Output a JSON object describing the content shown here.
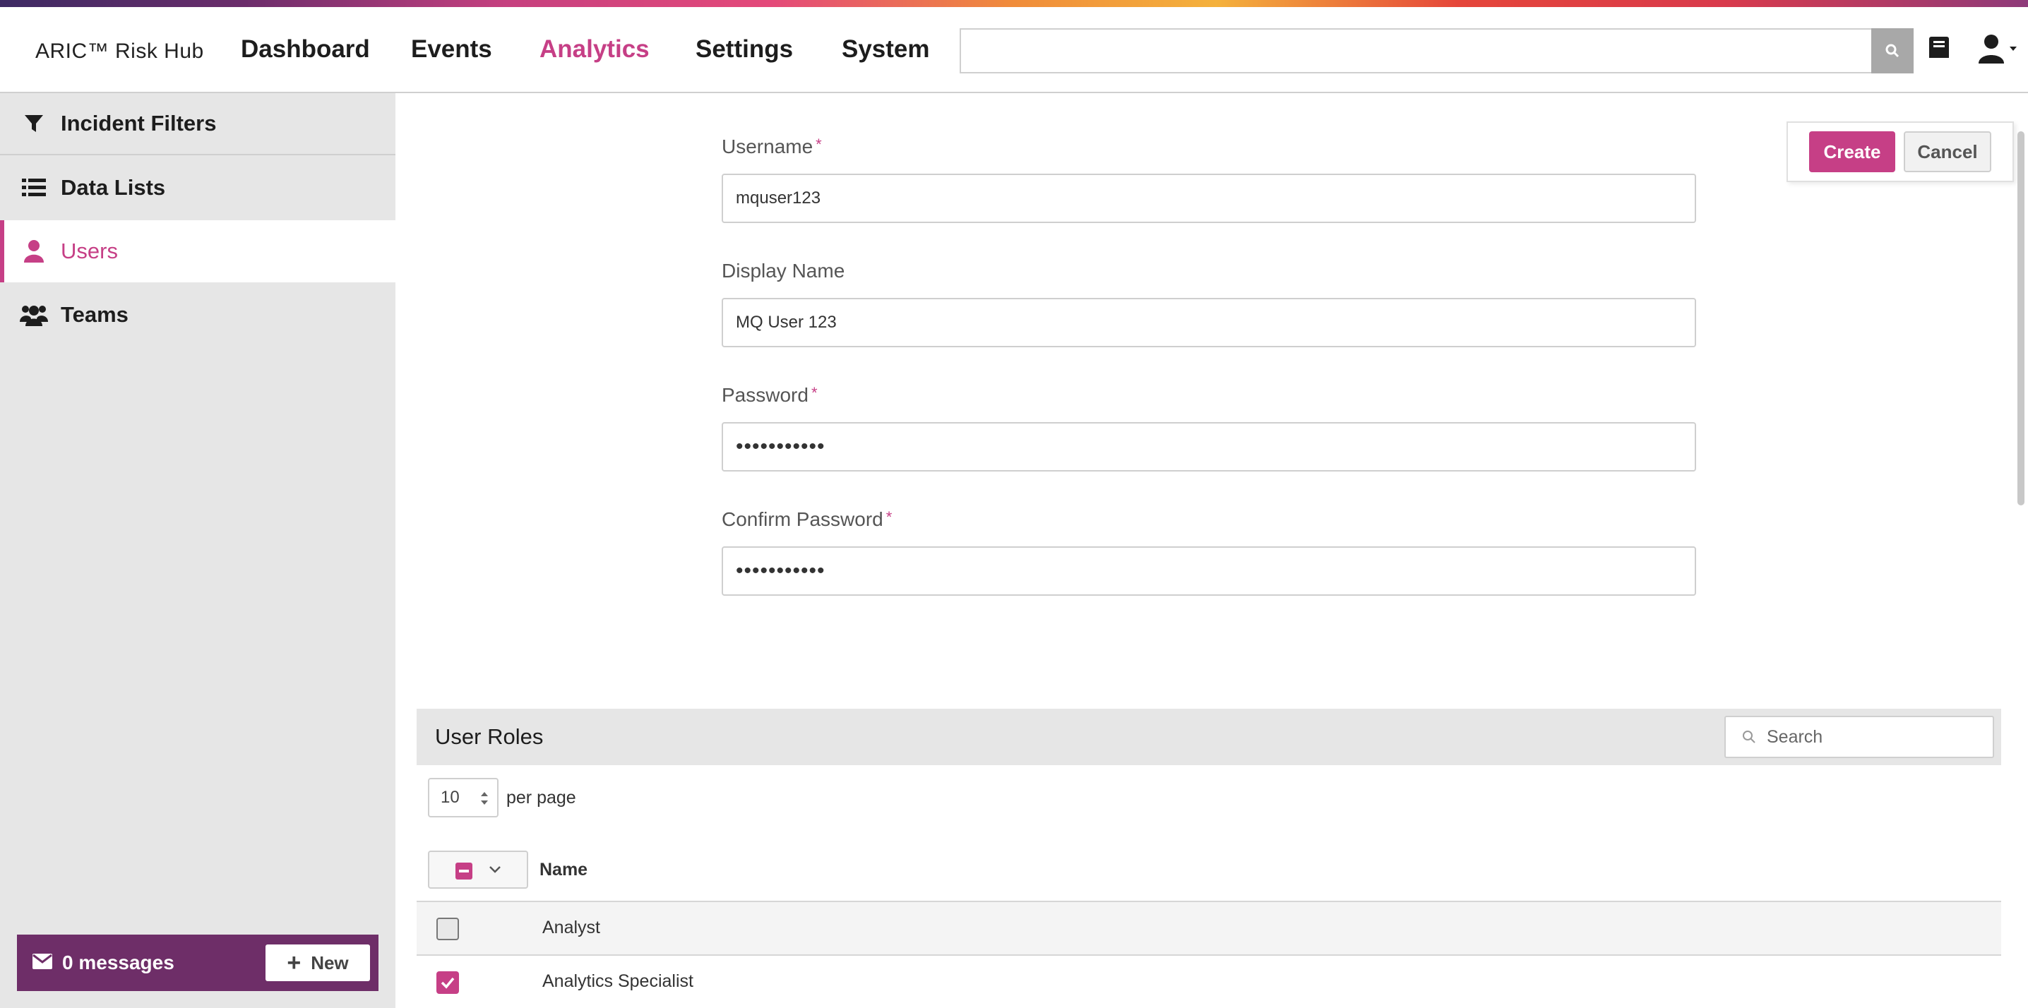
{
  "header": {
    "brand": "ARIC™ Risk Hub",
    "nav": [
      "Dashboard",
      "Events",
      "Analytics",
      "Settings",
      "System"
    ],
    "active_nav": "Analytics",
    "search_value": ""
  },
  "sidebar": {
    "items": [
      {
        "label": "Incident Filters",
        "icon": "filter-icon"
      },
      {
        "label": "Data Lists",
        "icon": "list-icon"
      },
      {
        "label": "Users",
        "icon": "user-icon"
      },
      {
        "label": "Teams",
        "icon": "users-icon"
      }
    ],
    "active_item": "Users",
    "messages": {
      "text": "0 messages",
      "new_label": "New"
    }
  },
  "form": {
    "username": {
      "label": "Username",
      "value": "mquser123",
      "required": true
    },
    "display_name": {
      "label": "Display Name",
      "value": "MQ User 123",
      "required": false
    },
    "password": {
      "label": "Password",
      "value": "•••••••••••",
      "required": true
    },
    "confirm_password": {
      "label": "Confirm Password",
      "value": "•••••••••••",
      "required": true
    },
    "required_marker": "*",
    "create_label": "Create",
    "cancel_label": "Cancel"
  },
  "roles": {
    "title": "User Roles",
    "search_placeholder": "Search",
    "per_page_value": "10",
    "per_page_label": "per page",
    "column_name": "Name",
    "rows": [
      {
        "name": "Analyst",
        "checked": false
      },
      {
        "name": "Analytics Specialist",
        "checked": true
      }
    ]
  },
  "colors": {
    "accent": "#c63f86",
    "message_bar": "#6e2e68",
    "sidebar_bg": "#e6e6e6"
  }
}
